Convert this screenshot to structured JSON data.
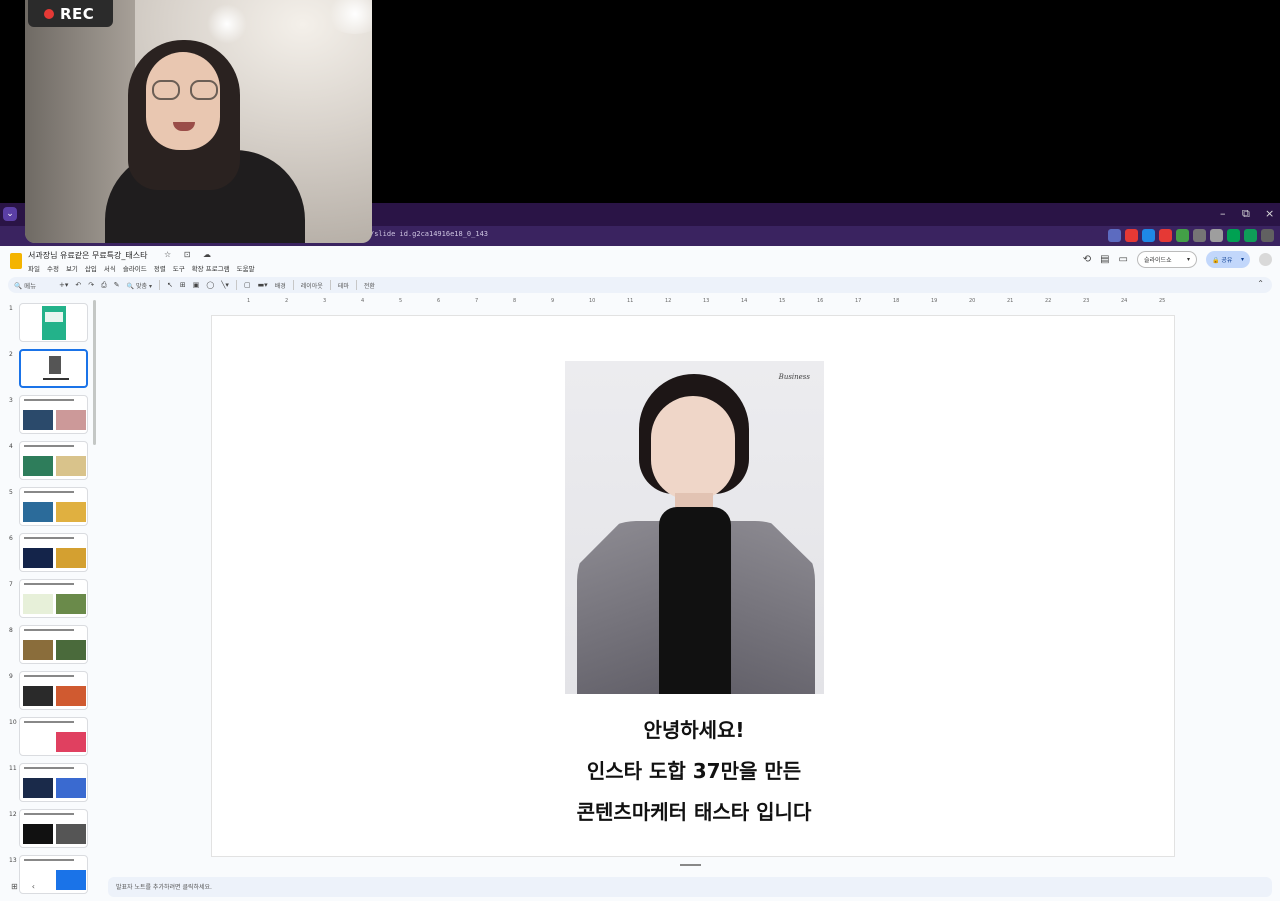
{
  "recording": {
    "label": "REC"
  },
  "window": {
    "minimize": "–",
    "restore": "⧉",
    "close": "×"
  },
  "browser": {
    "url": "/slide    id.g2ca14916e18_0_143",
    "extensions": [
      {
        "icon": "search-icon",
        "color": "#3a2360"
      },
      {
        "icon": "star-icon",
        "color": "#3a2360"
      },
      {
        "icon": "ext-n-icon",
        "color": "#5c6bc0"
      },
      {
        "icon": "ext-red-icon",
        "color": "#e53935"
      },
      {
        "icon": "ext-blue-icon",
        "color": "#1e88e5"
      },
      {
        "icon": "ext-grammar-icon",
        "color": "#e53935"
      },
      {
        "icon": "ext-wave-icon",
        "color": "#43a047"
      },
      {
        "icon": "ext-cam-icon",
        "color": "#757575"
      },
      {
        "icon": "ext-doc-icon",
        "color": "#9e9e9e"
      },
      {
        "icon": "ext-green-icon",
        "color": "#00a152"
      },
      {
        "icon": "ext-sheet-icon",
        "color": "#0f9d58"
      },
      {
        "icon": "puzzle-icon",
        "color": "#616161"
      }
    ]
  },
  "doc": {
    "title": "서과장님 유료같은 무료특강_태스타",
    "title_icons": "☆ ⊡ ☁",
    "menus": [
      "파일",
      "수정",
      "보기",
      "삽입",
      "서식",
      "슬라이드",
      "정렬",
      "도구",
      "확장 프로그램",
      "도움말"
    ]
  },
  "header": {
    "slideshow_label": "슬라이드쇼",
    "share_label": "🔒 공유"
  },
  "toolbar": {
    "search": "메뉴",
    "zoom": "맞춤",
    "background": "배경",
    "layout": "레이아웃",
    "theme": "테마",
    "transition": "전환"
  },
  "ruler": [
    "1",
    "2",
    "3",
    "4",
    "5",
    "6",
    "7",
    "8",
    "9",
    "10",
    "11",
    "12",
    "13",
    "14",
    "15",
    "16",
    "17",
    "18",
    "19",
    "20",
    "21",
    "22",
    "23",
    "24",
    "25"
  ],
  "thumbnails": [
    {
      "num": "1"
    },
    {
      "num": "2"
    },
    {
      "num": "3"
    },
    {
      "num": "4"
    },
    {
      "num": "5"
    },
    {
      "num": "6"
    },
    {
      "num": "7"
    },
    {
      "num": "8"
    },
    {
      "num": "9"
    },
    {
      "num": "10"
    },
    {
      "num": "11"
    },
    {
      "num": "12"
    },
    {
      "num": "13"
    }
  ],
  "slide": {
    "brand": "Business",
    "line1": "안녕하세요!",
    "line2": "인스타 도합 37만을 만든",
    "line3": "콘텐츠마케터 태스타 입니다"
  },
  "notes": {
    "placeholder": "발표자 노트를 추가하려면 클릭하세요."
  },
  "colors": {
    "accent": "#1a73e8",
    "browser_frame": "#3a2360",
    "doc_icon": "#f4b400"
  }
}
